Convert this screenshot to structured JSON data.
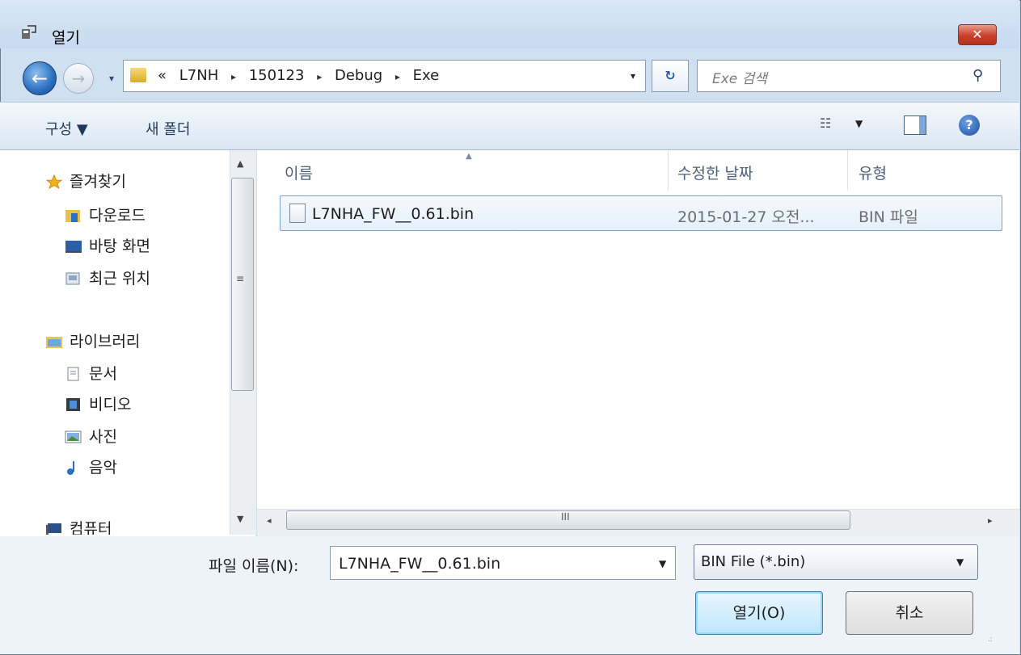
{
  "window": {
    "title": "열기",
    "close_glyph": "✕"
  },
  "nav": {
    "back_glyph": "←",
    "forward_glyph": "→",
    "history_glyph": "▾",
    "address": {
      "overflow": "«",
      "crumbs": [
        "L7NH",
        "150123",
        "Debug",
        "Exe"
      ],
      "separator": "▸",
      "dropdown_glyph": "▾"
    },
    "refresh_glyph": "↻",
    "search_placeholder": "Exe 검색",
    "search_glyph": "⚲"
  },
  "toolbar": {
    "organize_label": "구성 ▼",
    "new_folder_label": "새 폴더",
    "views_glyph": "☷",
    "views_drop": "▼",
    "help_glyph": "?"
  },
  "sidebar": {
    "favorites": {
      "label": "즐겨찾기",
      "items": [
        {
          "label": "다운로드",
          "icon": "downloads-icon"
        },
        {
          "label": "바탕 화면",
          "icon": "desktop-icon"
        },
        {
          "label": "최근 위치",
          "icon": "recent-places-icon"
        }
      ]
    },
    "libraries": {
      "label": "라이브러리",
      "items": [
        {
          "label": "문서",
          "icon": "documents-icon"
        },
        {
          "label": "비디오",
          "icon": "videos-icon"
        },
        {
          "label": "사진",
          "icon": "pictures-icon"
        },
        {
          "label": "음악",
          "icon": "music-icon"
        }
      ]
    },
    "computer": {
      "label": "컴퓨터"
    }
  },
  "file_list": {
    "columns": [
      "이름",
      "수정한 날짜",
      "유형"
    ],
    "rows": [
      {
        "name": "L7NHA_FW__0.61.bin",
        "date": "2015-01-27 오전...",
        "type": "BIN 파일"
      }
    ]
  },
  "scrollbars": {
    "up": "▲",
    "down": "▼",
    "left": "◂",
    "right": "▸",
    "grip_v": "≡",
    "grip_h": "III",
    "sort": "▲"
  },
  "footer": {
    "filename_label": "파일 이름(N):",
    "filename_value": "L7NHA_FW__0.61.bin",
    "filename_drop": "▼",
    "filetype_value": "BIN File (*.bin)",
    "filetype_drop": "▼",
    "open_label": "열기(O)",
    "cancel_label": "취소",
    "grip": ".:"
  }
}
